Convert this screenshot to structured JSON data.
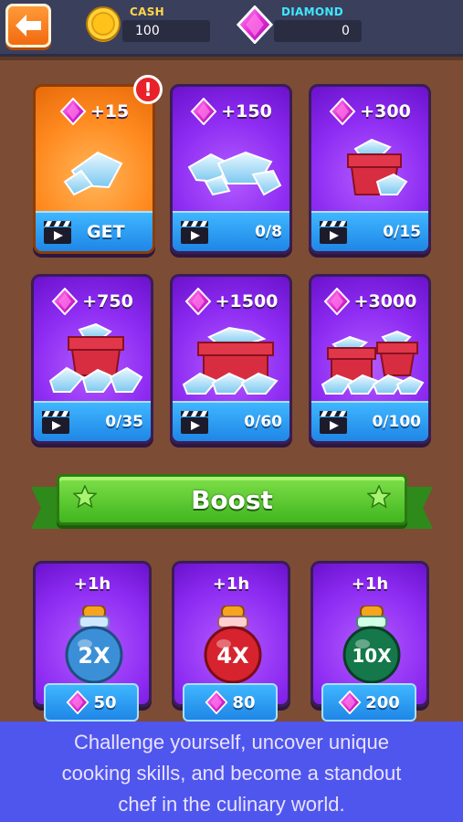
{
  "header": {
    "cash_label": "CASH",
    "cash_value": "100",
    "diamond_label": "DIAMOND",
    "diamond_value": "0"
  },
  "offers": [
    {
      "reward": "+15",
      "action": "GET",
      "highlight": true,
      "alert": "!"
    },
    {
      "reward": "+150",
      "progress": "0/8"
    },
    {
      "reward": "+300",
      "progress": "0/15"
    },
    {
      "reward": "+750",
      "progress": "0/35"
    },
    {
      "reward": "+1500",
      "progress": "0/60"
    },
    {
      "reward": "+3000",
      "progress": "0/100"
    }
  ],
  "boost": {
    "title": "Boost",
    "items": [
      {
        "duration": "+1h",
        "multiplier": "2X",
        "price": "50",
        "color": "#3b8fd6"
      },
      {
        "duration": "+1h",
        "multiplier": "4X",
        "price": "80",
        "color": "#d6232e"
      },
      {
        "duration": "+1h",
        "multiplier": "10X",
        "price": "200",
        "color": "#14784a"
      }
    ]
  },
  "caption": {
    "line1": "Challenge yourself, uncover unique",
    "line2": "cooking skills, and become a standout",
    "line3": "chef in the culinary world."
  },
  "colors": {
    "gem": "#e52bd6",
    "card_purple": "#8d2bf2",
    "card_orange": "#ff8a1f",
    "button_blue": "#2a9af0",
    "boost_green": "#41b51f"
  }
}
